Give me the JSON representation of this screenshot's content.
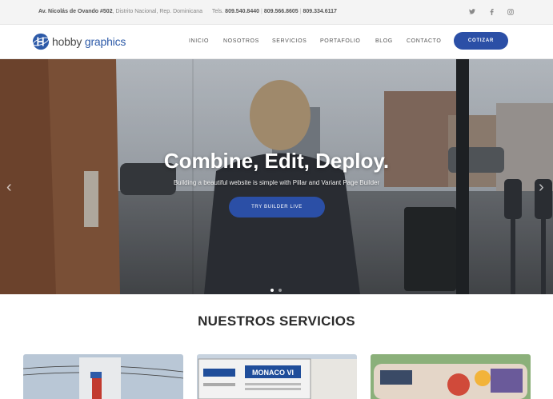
{
  "topbar": {
    "address_bold": "Av. Nicolás de Ovando #502",
    "address_rest": ", Distrito Nacional, Rep. Dominicana",
    "tels_label": "Tels.",
    "phone1": "809.540.8440",
    "phone2": "809.566.8605",
    "phone3": "809.334.6117",
    "social": [
      "twitter-icon",
      "facebook-icon",
      "instagram-icon"
    ]
  },
  "brand": {
    "word1": "hobby",
    "word2": "graphics",
    "color": "#2d5aa8"
  },
  "nav": {
    "items": [
      "INICIO",
      "NOSOTROS",
      "SERVICIOS",
      "PORTAFOLIO",
      "BLOG",
      "CONTACTO"
    ],
    "cta": "COTIZAR"
  },
  "hero": {
    "title": "Combine, Edit, Deploy.",
    "subtitle": "Building a beautiful website is simple with Pillar and Variant Page Builder",
    "button": "TRY BUILDER LIVE",
    "slides_total": 2,
    "active_slide": 1
  },
  "services": {
    "title": "NUESTROS SERVICIOS"
  },
  "colors": {
    "accent": "#2b4fa6"
  }
}
